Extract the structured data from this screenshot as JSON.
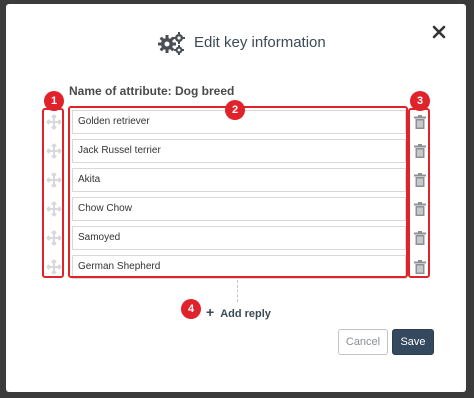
{
  "modal": {
    "title": "Edit key information",
    "close_label": "×",
    "attribute_label": "Name of attribute: Dog breed",
    "replies": [
      {
        "value": "Golden retriever"
      },
      {
        "value": "Jack Russel terrier"
      },
      {
        "value": "Akita"
      },
      {
        "value": "Chow Chow"
      },
      {
        "value": "Samoyed"
      },
      {
        "value": "German Shepherd"
      }
    ],
    "add_reply_label": "Add reply",
    "add_reply_icon": "+",
    "cancel_label": "Cancel",
    "save_label": "Save"
  },
  "annotations": {
    "badges": [
      "1",
      "2",
      "3",
      "4"
    ]
  },
  "colors": {
    "annotation_red": "#e0222a",
    "primary_button": "#34495e",
    "title_text": "#3c4a56"
  },
  "icons": {
    "header": "gears-icon",
    "close": "close-icon",
    "handle": "drag-handle-icon",
    "delete": "trash-icon"
  }
}
